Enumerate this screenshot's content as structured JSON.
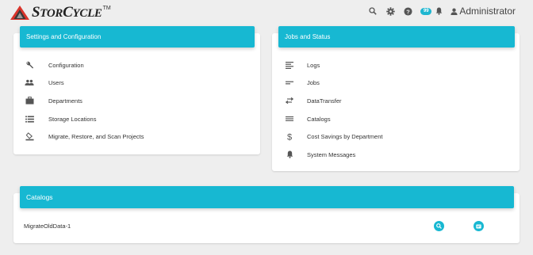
{
  "brand": {
    "name_big": "S",
    "name_mid": "TOR",
    "name_big2": "C",
    "name_mid2": "YCLE",
    "tm": "TM"
  },
  "topbar": {
    "badge_count": "99",
    "user_name": "Administrator"
  },
  "settings_card": {
    "title": "Settings and Configuration",
    "items": [
      {
        "label": "Configuration",
        "icon": "wrench-icon"
      },
      {
        "label": "Users",
        "icon": "users-icon"
      },
      {
        "label": "Departments",
        "icon": "briefcase-icon"
      },
      {
        "label": "Storage Locations",
        "icon": "list-icon"
      },
      {
        "label": "Migrate, Restore, and Scan Projects",
        "icon": "projects-icon"
      }
    ]
  },
  "jobs_card": {
    "title": "Jobs and Status",
    "items": [
      {
        "label": "Logs",
        "icon": "log-icon"
      },
      {
        "label": "Jobs",
        "icon": "jobs-icon"
      },
      {
        "label": "DataTransfer",
        "icon": "transfer-icon"
      },
      {
        "label": "Catalogs",
        "icon": "catalog-icon"
      },
      {
        "label": "Cost Savings by Department",
        "icon": "dollar-icon"
      },
      {
        "label": "System Messages",
        "icon": "bell-icon"
      }
    ]
  },
  "catalogs_card": {
    "title": "Catalogs",
    "rows": [
      {
        "name": "MigrateOldData-1"
      }
    ]
  },
  "colors": {
    "accent": "#17b8d2",
    "background": "#eeeeee",
    "icon_gray": "#555555",
    "logo_red": "#d9342b"
  }
}
